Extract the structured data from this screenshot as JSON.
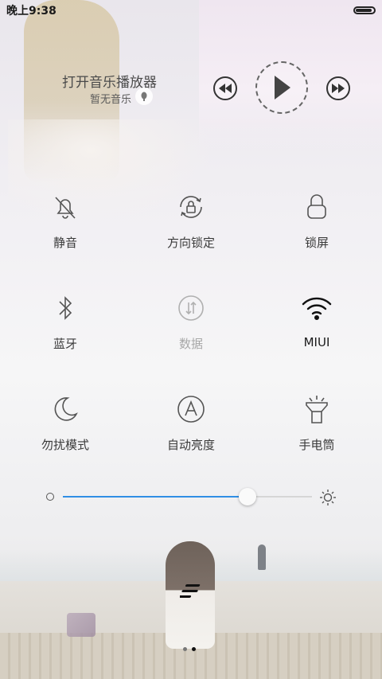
{
  "status_bar": {
    "time": "晚上9:38",
    "battery_level": 0.9
  },
  "music": {
    "title": "打开音乐播放器",
    "subtitle": "暂无音乐",
    "controls": [
      "previous-icon",
      "play-icon",
      "next-icon"
    ]
  },
  "toggles": [
    {
      "label": "静音",
      "icon": "bell-muted-icon",
      "state": "off"
    },
    {
      "label": "方向锁定",
      "icon": "rotation-lock-icon",
      "state": "off"
    },
    {
      "label": "锁屏",
      "icon": "lock-icon",
      "state": "off"
    },
    {
      "label": "蓝牙",
      "icon": "bluetooth-icon",
      "state": "off"
    },
    {
      "label": "数据",
      "icon": "mobile-data-icon",
      "state": "disabled"
    },
    {
      "label": "MIUI",
      "icon": "wifi-icon",
      "state": "on"
    },
    {
      "label": "勿扰模式",
      "icon": "moon-icon",
      "state": "off"
    },
    {
      "label": "自动亮度",
      "icon": "auto-brightness-icon",
      "state": "off"
    },
    {
      "label": "手电筒",
      "icon": "flashlight-icon",
      "state": "off"
    }
  ],
  "brightness": {
    "level_fraction": 0.74
  },
  "colors": {
    "slider_accent": "#2f8ee5",
    "icon": "#555555",
    "disabled": "#a8a8a8"
  },
  "pager": {
    "count": 2,
    "active_index": 1
  }
}
